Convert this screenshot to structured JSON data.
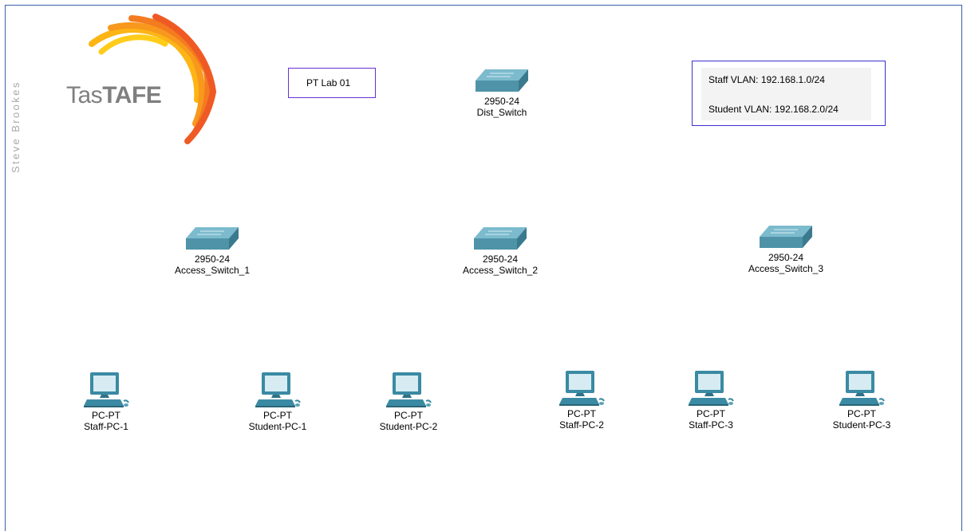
{
  "author": "Steve Brookes",
  "logo": {
    "text_regular": "Tas",
    "text_bold": "TAFE"
  },
  "notes": {
    "lab_title": "PT Lab 01",
    "vlans": [
      "Staff VLAN: 192.168.1.0/24",
      "Student VLAN: 192.168.2.0/24"
    ]
  },
  "switches": [
    {
      "model": "2950-24",
      "name": "Dist_Switch"
    },
    {
      "model": "2950-24",
      "name": "Access_Switch_1"
    },
    {
      "model": "2950-24",
      "name": "Access_Switch_2"
    },
    {
      "model": "2950-24",
      "name": "Access_Switch_3"
    }
  ],
  "pcs": [
    {
      "model": "PC-PT",
      "name": "Staff-PC-1"
    },
    {
      "model": "PC-PT",
      "name": "Student-PC-1"
    },
    {
      "model": "PC-PT",
      "name": "Student-PC-2"
    },
    {
      "model": "PC-PT",
      "name": "Staff-PC-2"
    },
    {
      "model": "PC-PT",
      "name": "Staff-PC-3"
    },
    {
      "model": "PC-PT",
      "name": "Student-PC-3"
    }
  ],
  "colors": {
    "switch_top": "#6fb0c4",
    "switch_side": "#3f7f93",
    "pc_body": "#3b8aa3",
    "note_border": "#6a2fd0",
    "logo_orange": "#f26522",
    "logo_yellow": "#ffc20e"
  }
}
